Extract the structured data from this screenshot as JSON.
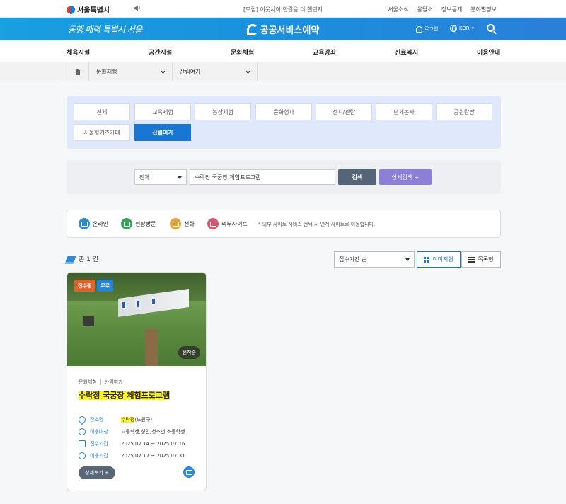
{
  "topbar": {
    "logo_text": "서울특별시",
    "notice": "[모집] 이웃사이 한걸음 더 챌린지",
    "links": [
      "서울소식",
      "응답소",
      "정보공개",
      "분야별정보"
    ]
  },
  "header": {
    "slogan": "동행 매력 특별시 서울",
    "brand": "공공서비스예약",
    "login": "로그인",
    "lang": "KOR"
  },
  "nav": {
    "items": [
      "체육시설",
      "공간시설",
      "문화체험",
      "교육강좌",
      "진료복지",
      "이용안내"
    ]
  },
  "breadcrumb": {
    "level1": "문화체험",
    "level2": "산림여가"
  },
  "categories": [
    {
      "label": "전체"
    },
    {
      "label": "교육체험"
    },
    {
      "label": "농장체험"
    },
    {
      "label": "문화행사"
    },
    {
      "label": "전시/관람"
    },
    {
      "label": "단체봉사"
    },
    {
      "label": "공원탐방"
    },
    {
      "label": "서울형키즈카페"
    },
    {
      "label": "산림여가",
      "active": true
    }
  ],
  "search": {
    "scope": "전체",
    "query": "수락정 국궁장 체험프로그램",
    "search_label": "검색",
    "detail_label": "상세검색 +"
  },
  "legend": {
    "items": [
      {
        "label": "온라인",
        "color": "#2d8ad6"
      },
      {
        "label": "현장방문",
        "color": "#3aa35a"
      },
      {
        "label": "전화",
        "color": "#f0a030"
      },
      {
        "label": "외부사이트",
        "color": "#e0566e"
      }
    ],
    "note": "* 외부 사이트 서비스 선택 시 연계 사이트로 이동합니다."
  },
  "results": {
    "total": "총 1 건",
    "sort": "접수기간 순",
    "view_image": "이미지형",
    "view_list": "목록형"
  },
  "card": {
    "badge_status": "접수중",
    "badge_fee": "무료",
    "first_come": "선착순",
    "cat1": "문화체험",
    "cat2": "산림여가",
    "title": "수락정 국궁장 체험프로그램",
    "place_label": "장소명",
    "place_highlight": "수락정",
    "place_rest": "(노원구)",
    "target_label": "이용대상",
    "target_value": "고등학생,성인,청소년,초등학생",
    "apply_label": "접수기간",
    "apply_value": "2025.07.14 ~ 2025.07.16",
    "use_label": "이용기간",
    "use_value": "2025.07.17 ~ 2025.07.31",
    "detail_label": "상세보기 +"
  }
}
